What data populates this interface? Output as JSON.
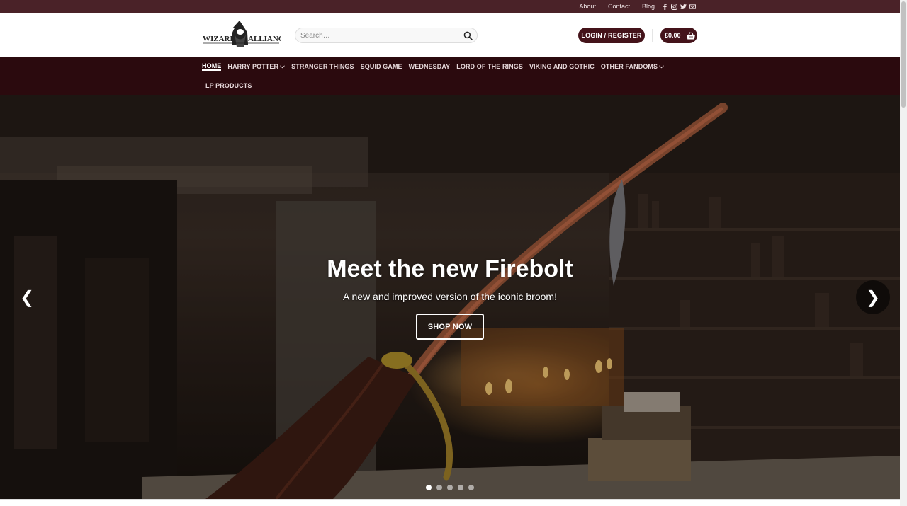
{
  "topbar": {
    "links": [
      "About",
      "Contact",
      "Blog"
    ],
    "social_icons": [
      "facebook-icon",
      "instagram-icon",
      "twitter-icon",
      "email-icon"
    ]
  },
  "header": {
    "logo_alt": "Wizard Alliance",
    "search": {
      "placeholder": "Search…"
    },
    "login_label": "LOGIN / REGISTER",
    "cart_total": "£0.00"
  },
  "nav": {
    "items": [
      {
        "label": "HOME",
        "active": true
      },
      {
        "label": "HARRY POTTER",
        "dropdown": true
      },
      {
        "label": "STRANGER THINGS"
      },
      {
        "label": "SQUID GAME"
      },
      {
        "label": "WEDNESDAY"
      },
      {
        "label": "LORD OF THE RINGS"
      },
      {
        "label": "VIKING AND GOTHIC"
      },
      {
        "label": "OTHER FANDOMS",
        "dropdown": true
      },
      {
        "label": "LP PRODUCTS"
      }
    ]
  },
  "hero": {
    "title": "Meet the new Firebolt",
    "subtitle": "A new and improved version of the iconic broom!",
    "button_label": "SHOP NOW",
    "prev_arrow": "❮",
    "next_arrow": "❯",
    "slide_count": 5,
    "active_slide": 1
  },
  "colors": {
    "topbar": "#4a2228",
    "nav": "#2b0a0e",
    "accent": "#44131a"
  }
}
